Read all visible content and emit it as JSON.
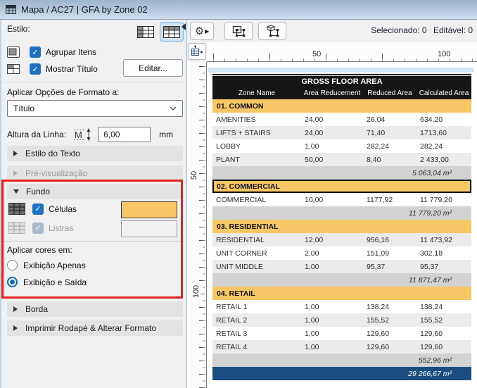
{
  "window": {
    "title": "Mapa / AC27 | GFA by Zone 02"
  },
  "panel": {
    "style_label": "Estilo:",
    "group_items_label": "Agrupar Itens",
    "show_title_label": "Mostrar Título",
    "edit_button_label": "Editar...",
    "apply_format_label": "Aplicar Opções de Formato a:",
    "format_value": "Título",
    "row_height_label": "Altura da Linha:",
    "row_height_value": "6,00",
    "row_height_unit": "mm",
    "section_text_style": "Estilo do Texto",
    "section_preview": "Pré-visualização",
    "section_background": "Fundo",
    "section_border": "Borda",
    "section_print": "Imprimir Rodapé & Alterar Formato",
    "cells_label": "Células",
    "stripes_label": "Listras",
    "apply_colors_label": "Aplicar cores em:",
    "radio_display_only": "Exibição Apenas",
    "radio_display_output": "Exibição e Saída",
    "cells_color": "#F7C766",
    "stripes_color": "#F1F1F1",
    "highlight_color": "#E0231C"
  },
  "toolbar": {
    "selected": "Selecionado: 0",
    "editable": "Editável: 0"
  },
  "ruler": {
    "h_labels": [
      "50",
      "100"
    ],
    "v_labels": [
      "50",
      "100"
    ]
  },
  "table": {
    "title": "GROSS FLOOR AREA",
    "columns": [
      "Zone Name",
      "Area Reducement",
      "Reduced Area",
      "Calculated Area"
    ],
    "group_color": "#F7C766",
    "total_color": "#1C4D80",
    "rows": [
      {
        "type": "group",
        "name": "01. COMMON"
      },
      {
        "type": "data",
        "shade": "white",
        "cells": [
          "AMENITIES",
          "24,00",
          "26,04",
          "634,20"
        ]
      },
      {
        "type": "data",
        "shade": "stripe",
        "cells": [
          "LIFTS + STAIRS",
          "24,00",
          "71,40",
          "1713,60"
        ]
      },
      {
        "type": "data",
        "shade": "white",
        "cells": [
          "LOBBY",
          "1,00",
          "282,24",
          "282,24"
        ]
      },
      {
        "type": "data",
        "shade": "stripe",
        "cells": [
          "PLANT",
          "50,00",
          "8,40",
          "2 433,00"
        ]
      },
      {
        "type": "subtotal",
        "value": "5 063,04 m²"
      },
      {
        "type": "group",
        "name": "02. COMMERCIAL",
        "selected": true
      },
      {
        "type": "data",
        "shade": "white",
        "cells": [
          "COMMERCIAL",
          "10,00",
          "1177,92",
          "11 779,20"
        ]
      },
      {
        "type": "subtotal",
        "value": "11 779,20 m²"
      },
      {
        "type": "group",
        "name": "03. RESIDENTIAL"
      },
      {
        "type": "data",
        "shade": "stripe",
        "cells": [
          "RESIDENTIAL",
          "12,00",
          "956,16",
          "11 473,92"
        ]
      },
      {
        "type": "data",
        "shade": "white",
        "cells": [
          "UNIT CORNER",
          "2,00",
          "151,09",
          "302,18"
        ]
      },
      {
        "type": "data",
        "shade": "stripe",
        "cells": [
          "UNIT MIDDLE",
          "1,00",
          "95,37",
          "95,37"
        ]
      },
      {
        "type": "subtotal",
        "value": "11 871,47 m²"
      },
      {
        "type": "group",
        "name": "04. RETAIL"
      },
      {
        "type": "data",
        "shade": "white",
        "cells": [
          "RETAIL 1",
          "1,00",
          "138,24",
          "138,24"
        ]
      },
      {
        "type": "data",
        "shade": "stripe",
        "cells": [
          "RETAIL 2",
          "1,00",
          "155,52",
          "155,52"
        ]
      },
      {
        "type": "data",
        "shade": "white",
        "cells": [
          "RETAIL 3",
          "1,00",
          "129,60",
          "129,60"
        ]
      },
      {
        "type": "data",
        "shade": "stripe",
        "cells": [
          "RETAIL 4",
          "1,00",
          "129,60",
          "129,60"
        ]
      },
      {
        "type": "subtotal",
        "value": "552,96 m²"
      },
      {
        "type": "total",
        "value": "29 266,67 m²"
      }
    ]
  }
}
